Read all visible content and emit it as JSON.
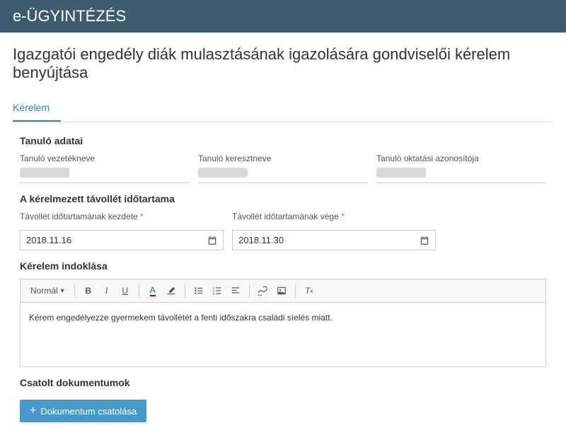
{
  "header": {
    "title": "e-ÜGYINTÉZÉS"
  },
  "page": {
    "title": "Igazgatói engedély diák mulasztásának igazolására gondviselői kérelem benyújtása"
  },
  "tabs": {
    "active": "Kérelem"
  },
  "student": {
    "section_title": "Tanuló adatai",
    "surname_label": "Tanuló vezetékneve",
    "firstname_label": "Tanuló keresztneve",
    "eduid_label": "Tanuló oktatási azonosítója"
  },
  "absence": {
    "section_title": "A kérelmezett távollét időtartama",
    "start_label": "Távollét időtartamának kezdete",
    "end_label": "Távollét időtartamának vége",
    "start_value": "2018.11.16",
    "end_value": "2018.11.30"
  },
  "justification": {
    "section_title": "Kérelem indoklása",
    "format_label": "Normál",
    "body": "Kérem engedélyezze gyermekem távollétét a fenti időszakra családi síelés miatt."
  },
  "attachments": {
    "section_title": "Csatolt dokumentumok",
    "button_label": "Dokumentum csatolása"
  },
  "required_marker": "*"
}
